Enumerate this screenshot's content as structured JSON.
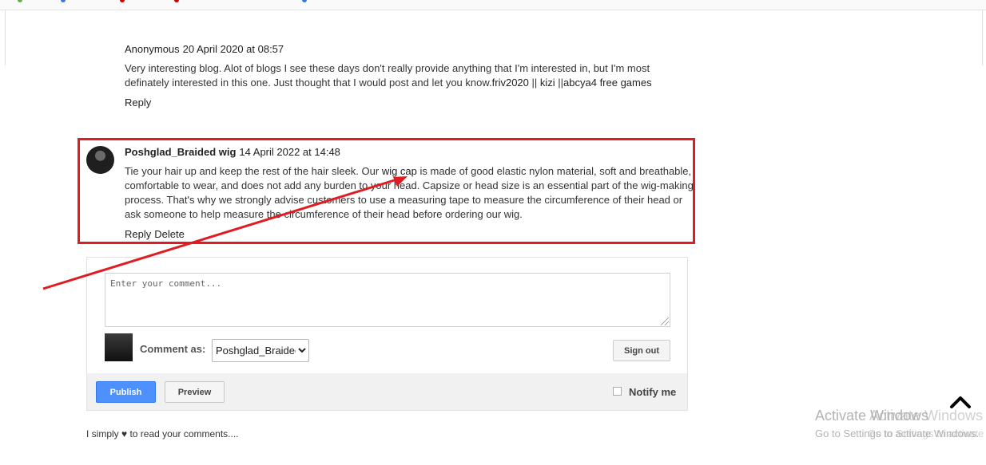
{
  "comments": [
    {
      "author": "Anonymous",
      "timestamp": "20 April 2020 at 08:57",
      "body_part1": "Very interesting blog. Alot of blogs I see these days don't really provide anything that I'm interested in, but I'm most definately interested in this one. Just thought that I would post and let you know.",
      "links": [
        "friv2020",
        "kizi",
        "abcya4 free games"
      ],
      "separators": [
        " || ",
        " ||"
      ],
      "reply_label": "Reply"
    },
    {
      "author": "Poshglad_Braided wig",
      "timestamp": "14 April 2022 at 14:48",
      "body_before_link": "Tie your hair up and keep the rest of the hair sleek. Our ",
      "link": "wig cap",
      "body_after_link": " is made of good elastic nylon material, soft and breathable, comfortable to wear, and does not add any burden to your head. Capsize or head size is an essential part of the wig-making process. That's why we strongly advise customers to use a measuring tape to measure the circumference of their head or ask someone to help measure the circumference of their head before ordering our wig.",
      "reply_label": "Reply",
      "delete_label": "Delete"
    }
  ],
  "comment_form": {
    "placeholder": "Enter your comment...",
    "comment_as_label": "Comment as:",
    "identity_selected": "Poshglad_Braided wig",
    "sign_out_label": "Sign out",
    "publish_label": "Publish",
    "preview_label": "Preview",
    "notify_label": "Notify me"
  },
  "footnote": "I simply ♥ to read your comments....",
  "watermark": {
    "title": "Activate Windows",
    "subtitle": "Go to Settings to activate Windows."
  },
  "icons": [
    "back-to-top-chevron-icon",
    "annotation-arrow"
  ],
  "colors": {
    "highlight": "#e11b22",
    "publish": "#4d90fe"
  }
}
